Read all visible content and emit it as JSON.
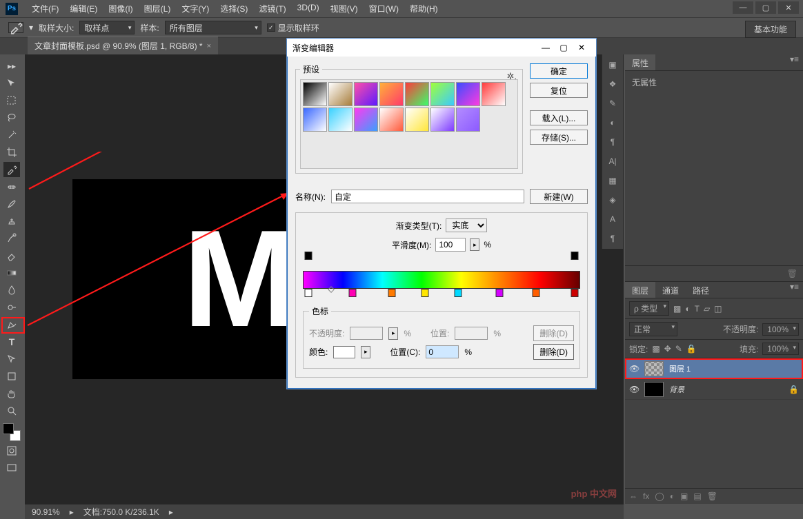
{
  "menubar": {
    "items": [
      "文件(F)",
      "编辑(E)",
      "图像(I)",
      "图层(L)",
      "文字(Y)",
      "选择(S)",
      "滤镜(T)",
      "3D(D)",
      "视图(V)",
      "窗口(W)",
      "帮助(H)"
    ]
  },
  "window": {
    "min": "—",
    "max": "▢",
    "close": "✕"
  },
  "options": {
    "sample_size_label": "取样大小:",
    "sample_size_value": "取样点",
    "sample_label": "样本:",
    "sample_value": "所有图层",
    "show_ring_label": "显示取样环",
    "basic_func": "基本功能"
  },
  "doctab": {
    "title": "文章封面模板.psd @ 90.9% (图层 1, RGB/8) *",
    "close": "×"
  },
  "canvas": {
    "text": "Ma"
  },
  "dialog": {
    "title": "渐变编辑器",
    "presets_legend": "预设",
    "swatches": [
      "linear-gradient(135deg,#000,#fff)",
      "linear-gradient(135deg,#fff,#a77c3a)",
      "linear-gradient(135deg,#ff4fa8,#5d1aff)",
      "linear-gradient(135deg,#ffb03a,#ff3a6a)",
      "linear-gradient(135deg,#ff3a3a,#3aff6a)",
      "linear-gradient(135deg,#a0ff3a,#3acaff)",
      "linear-gradient(135deg,#3a4dff,#ff3ae0)",
      "linear-gradient(135deg,#ff3a3a,#ffffff)",
      "linear-gradient(135deg,#3a68ff,#ffffff)",
      "linear-gradient(135deg,#3ad1ff,#ffffff)",
      "linear-gradient(135deg,#ff3af0,#3a9fff)",
      "linear-gradient(135deg,#fff,#ff5a3a)",
      "linear-gradient(135deg,#fff,#ffe63a)",
      "linear-gradient(135deg,#fff,#7d3aff)",
      "linear-gradient(135deg,#b38cff,#8c5aff)"
    ],
    "ok": "确定",
    "reset": "复位",
    "load": "载入(L)...",
    "save": "存储(S)...",
    "name_label": "名称(N):",
    "name_value": "自定",
    "new_btn": "新建(W)",
    "grad_type_label": "渐变类型(T):",
    "grad_type_value": "实底",
    "smooth_label": "平滑度(M):",
    "smooth_value": "100",
    "stops_legend": "色标",
    "opacity_label": "不透明度:",
    "location_label": "位置:",
    "color_label": "颜色:",
    "location_c_label": "位置(C):",
    "location_c_value": "0",
    "delete_d": "删除(D)",
    "percent": "%"
  },
  "panels": {
    "properties_tab": "属性",
    "no_properties": "无属性",
    "layers_tab": "图层",
    "channels_tab": "通道",
    "paths_tab": "路径",
    "kind_label": "ρ 类型",
    "blend_mode": "正常",
    "opacity_label": "不透明度:",
    "opacity_value": "100%",
    "lock_label": "锁定:",
    "fill_label": "填充:",
    "fill_value": "100%",
    "layers": [
      {
        "name": "图层 1",
        "selected": true,
        "highlighted": true,
        "thumb": "checker"
      },
      {
        "name": "背景",
        "selected": false,
        "highlighted": false,
        "thumb": "black",
        "locked": true
      }
    ]
  },
  "status": {
    "zoom": "90.91%",
    "doc": "文档:750.0 K/236.1K"
  },
  "watermark": "php 中文网"
}
